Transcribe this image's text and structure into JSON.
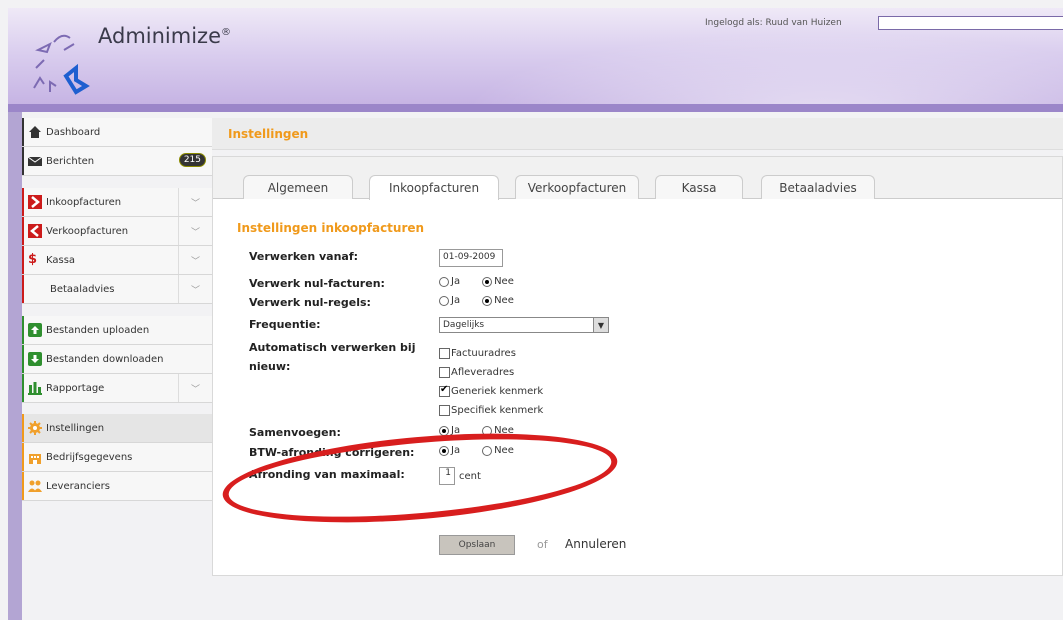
{
  "app": {
    "name": "Adminimize",
    "registered": "®",
    "login_text": "Ingelogd als: Ruud van Huizen"
  },
  "sidebar": {
    "items": [
      {
        "label": "Dashboard",
        "icon": "house-icon",
        "accent": "#333333"
      },
      {
        "label": "Berichten",
        "icon": "envelope-icon",
        "badge": "215",
        "accent": "#333333"
      },
      {
        "label": "Inkoopfacturen",
        "icon": "arrow-right-icon",
        "accent": "#cc1b1b"
      },
      {
        "label": "Verkoopfacturen",
        "icon": "arrow-left-icon",
        "accent": "#cc1b1b"
      },
      {
        "label": "Kassa",
        "icon": "dollar-icon",
        "accent": "#cc1b1b"
      },
      {
        "label": "Betaaladvies",
        "icon": "",
        "accent": "#cc1b1b"
      },
      {
        "label": "Bestanden uploaden",
        "icon": "upload-icon",
        "accent": "#2f8f2f"
      },
      {
        "label": "Bestanden downloaden",
        "icon": "download-icon",
        "accent": "#2f8f2f"
      },
      {
        "label": "Rapportage",
        "icon": "bar-chart-icon",
        "accent": "#2f8f2f"
      },
      {
        "label": "Instellingen",
        "icon": "gear-icon",
        "accent": "#f09a1c"
      },
      {
        "label": "Bedrijfsgegevens",
        "icon": "building-icon",
        "accent": "#f09a1c"
      },
      {
        "label": "Leveranciers",
        "icon": "people-icon",
        "accent": "#f09a1c"
      }
    ]
  },
  "main": {
    "title": "Instellingen",
    "tabs": [
      "Algemeen",
      "Inkoopfacturen",
      "Verkoopfacturen",
      "Kassa",
      "Betaaladvies"
    ],
    "active_tab": "Inkoopfacturen",
    "section_title": "Instellingen inkoopfacturen",
    "fields": {
      "verwerken_vanaf": {
        "label": "Verwerken vanaf:",
        "value": "01-09-2009"
      },
      "nul_facturen": {
        "label": "Verwerk nul-facturen:",
        "options": [
          "Ja",
          "Nee"
        ],
        "selected": "Nee"
      },
      "nul_regels": {
        "label": "Verwerk nul-regels:",
        "options": [
          "Ja",
          "Nee"
        ],
        "selected": "Nee"
      },
      "frequentie": {
        "label": "Frequentie:",
        "value": "Dagelijks"
      },
      "automatisch": {
        "label_line1": "Automatisch verwerken bij",
        "label_line2": "nieuw:",
        "options": [
          {
            "label": "Factuuradres",
            "checked": false
          },
          {
            "label": "Afleveradres",
            "checked": false
          },
          {
            "label": "Generiek kenmerk",
            "checked": true
          },
          {
            "label": "Specifiek kenmerk",
            "checked": false
          }
        ]
      },
      "samenvoegen": {
        "label": "Samenvoegen:",
        "options": [
          "Ja",
          "Nee"
        ],
        "selected": "Ja"
      },
      "btw_afronding": {
        "label": "BTW-afronding corrigeren:",
        "options": [
          "Ja",
          "Nee"
        ],
        "selected": "Ja"
      },
      "afronding_max": {
        "label": "Afronding van maximaal:",
        "value": "1",
        "unit": "cent"
      }
    },
    "save_label": "Opslaan",
    "or_text": "of",
    "cancel_label": "Annuleren"
  },
  "colors": {
    "accent_orange": "#f09a1c",
    "header_purple": "#c3b0e2",
    "highlight_red": "#d81e1e"
  }
}
